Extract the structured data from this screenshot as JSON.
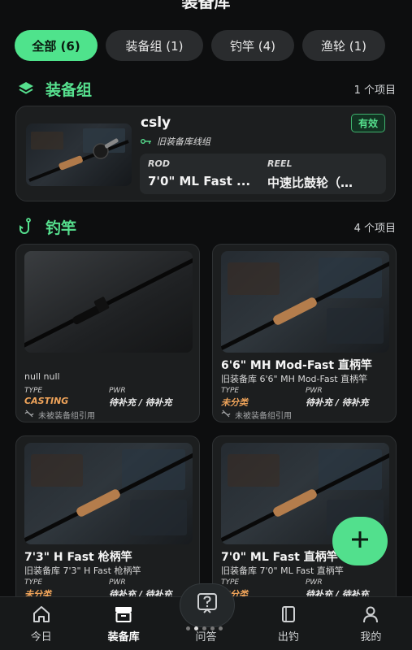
{
  "header": {
    "title": "装备库"
  },
  "filters": [
    {
      "label": "全部 (6)",
      "active": true
    },
    {
      "label": "装备组 (1)",
      "active": false
    },
    {
      "label": "钓竿 (4)",
      "active": false
    },
    {
      "label": "渔轮 (1)",
      "active": false
    }
  ],
  "gear_section": {
    "title": "装备组",
    "count": "1 个项目",
    "card": {
      "name": "csly",
      "subtitle": "旧装备库线组",
      "badge": "有效",
      "rod_label": "ROD",
      "rod_value": "7'0\" ML Fast ...",
      "reel_label": "REEL",
      "reel_value": "中速比鼓轮（…"
    }
  },
  "rod_section": {
    "title": "钓竿",
    "count": "4 个项目",
    "cards": [
      {
        "title": "",
        "subtitle": "null null",
        "type_label": "TYPE",
        "type_value": "CASTING",
        "pwr_label": "PWR",
        "pwr_value": "待补充 / 待补充",
        "unlinked": "未被装备组引用"
      },
      {
        "title": "6'6\" MH Mod-Fast 直柄竿",
        "subtitle": "旧装备库 6'6\" MH Mod-Fast 直柄竿",
        "type_label": "TYPE",
        "type_value": "未分类",
        "pwr_label": "PWR",
        "pwr_value": "待补充 / 待补充",
        "unlinked": "未被装备组引用"
      },
      {
        "title": "7'3\" H Fast 枪柄竿",
        "subtitle": "旧装备库 7'3\" H Fast 枪柄竿",
        "type_label": "TYPE",
        "type_value": "未分类",
        "pwr_label": "PWR",
        "pwr_value": "待补充 / 待补充",
        "unlinked": ""
      },
      {
        "title": "7'0\" ML Fast 直柄竿",
        "subtitle": "旧装备库 7'0\" ML Fast 直柄竿",
        "type_label": "TYPE",
        "type_value": "未分类",
        "pwr_label": "PWR",
        "pwr_value": "待补充 / 待补充",
        "unlinked": ""
      }
    ]
  },
  "fab": {
    "icon": "plus-icon"
  },
  "nav": {
    "items": [
      {
        "label": "今日",
        "icon": "home-icon"
      },
      {
        "label": "装备库",
        "icon": "archive-icon",
        "active": true
      },
      {
        "label": "问答",
        "icon": "help-icon"
      },
      {
        "label": "出钓",
        "icon": "book-icon"
      },
      {
        "label": "我的",
        "icon": "user-icon"
      }
    ]
  },
  "colors": {
    "accent": "#4fe38c",
    "orange": "#f0a45a",
    "background": "#0d0e0f",
    "card": "#1c1e1f"
  }
}
